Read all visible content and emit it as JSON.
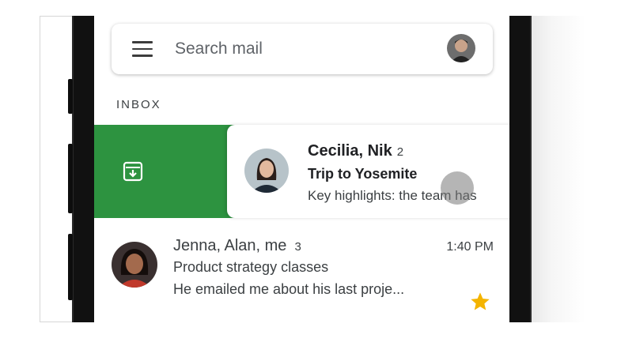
{
  "search": {
    "placeholder": "Search mail"
  },
  "folder": {
    "label": "INBOX"
  },
  "swipe_action": {
    "icon": "archive-icon",
    "color": "#2d9340"
  },
  "threads": [
    {
      "senders": "Cecilia, Nik",
      "count": "2",
      "subject": "Trip to Yosemite",
      "snippet": "Key highlights: the team has",
      "unread": true
    },
    {
      "senders": "Jenna, Alan, me",
      "count": "3",
      "time": "1:40 PM",
      "subject": "Product strategy classes",
      "snippet": "He emailed me about his last proje...",
      "starred": true,
      "star_color": "#f4b400"
    }
  ]
}
